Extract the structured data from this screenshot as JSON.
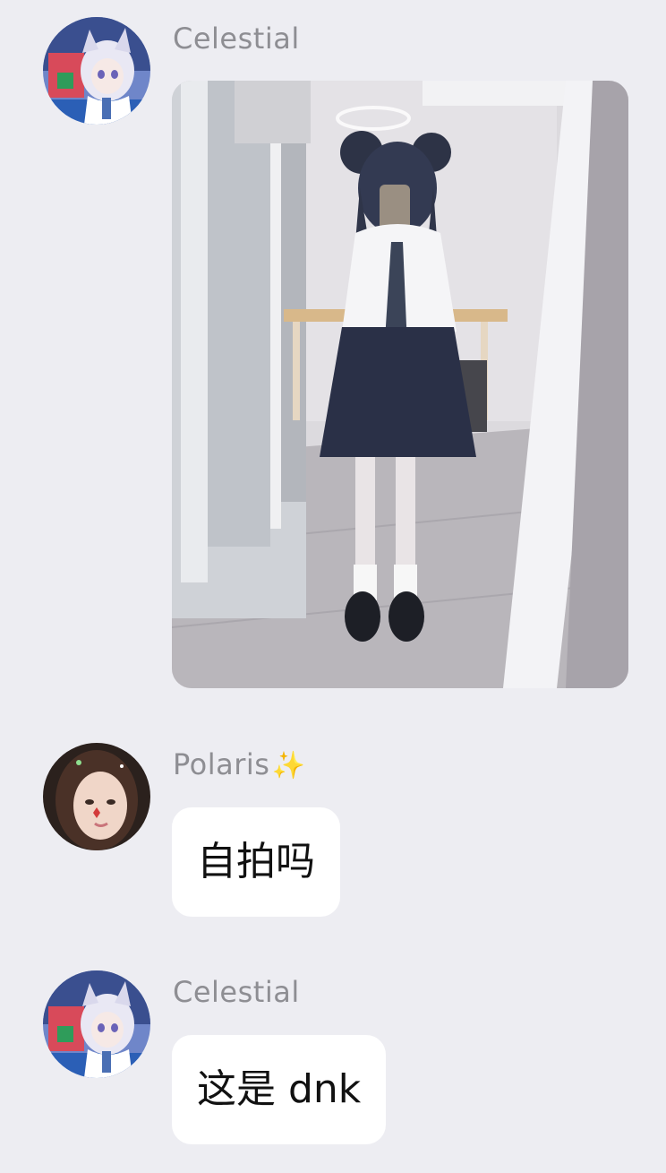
{
  "messages": [
    {
      "sender": "Celestial",
      "avatar_icon": "anime-avatar-icon",
      "kind": "image",
      "image_icon": "mirror-selfie-photo"
    },
    {
      "sender": "Polaris",
      "sender_emoji": "✨",
      "avatar_icon": "portrait-avatar-icon",
      "kind": "text",
      "text": "自拍吗"
    },
    {
      "sender": "Celestial",
      "avatar_icon": "anime-avatar-icon",
      "kind": "text",
      "text": "这是 dnk"
    }
  ],
  "colors": {
    "background": "#ededf2",
    "bubble": "#ffffff",
    "sender_name": "#8e8e93",
    "message_text": "#111111"
  }
}
